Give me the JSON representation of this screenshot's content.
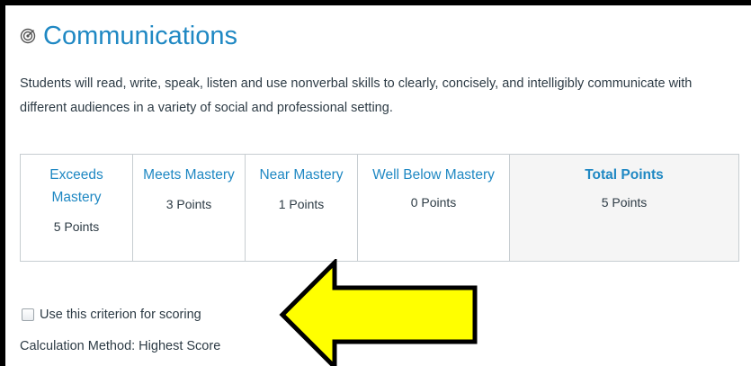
{
  "title": "Communications",
  "icon": "target-icon",
  "description": "Students will read, write, speak, listen and use nonverbal skills to clearly, concisely, and intelligibly communicate with different audiences in a variety of social and professional setting.",
  "ratings": [
    {
      "label": "Exceeds Mastery",
      "points": "5 Points"
    },
    {
      "label": "Meets Mastery",
      "points": "3 Points"
    },
    {
      "label": "Near Mastery",
      "points": "1 Points"
    },
    {
      "label": "Well Below Mastery",
      "points": "0 Points"
    }
  ],
  "total": {
    "label": "Total Points",
    "points": "5 Points"
  },
  "criterion_checkbox": {
    "label": "Use this criterion for scoring",
    "checked": false
  },
  "calculation_method": "Calculation Method: Highest Score",
  "colors": {
    "link_blue": "#1f88c3",
    "text": "#2d3b45",
    "arrow_fill": "#ffff00",
    "border": "#000000"
  }
}
